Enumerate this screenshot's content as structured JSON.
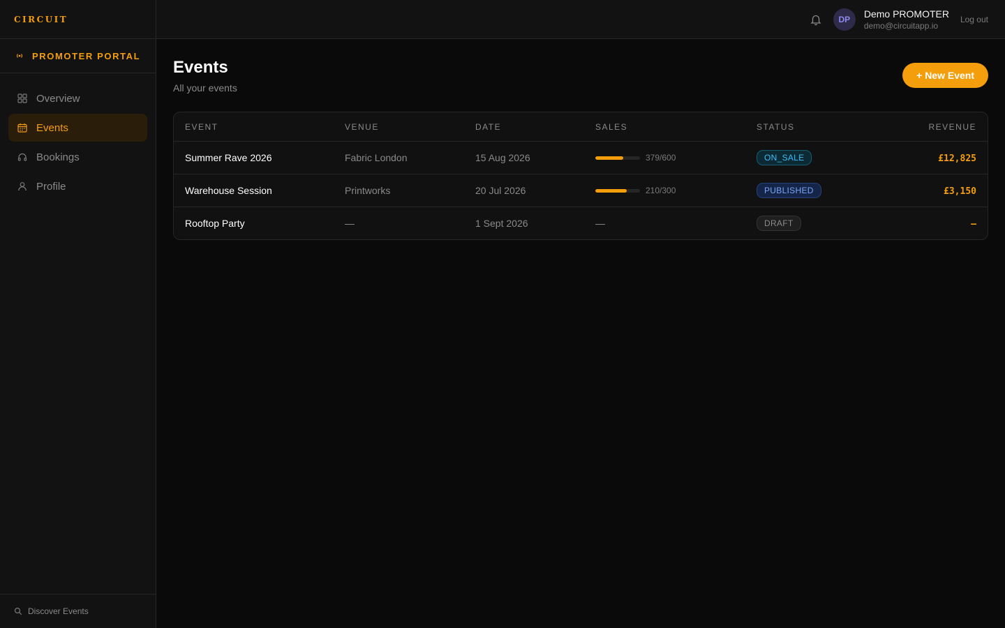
{
  "brand": {
    "logo": "CIRCUIT",
    "accent": "#f59e0b"
  },
  "portal": {
    "label": "PROMOTER PORTAL",
    "icon": "broadcast-icon"
  },
  "sidebar": {
    "items": [
      {
        "label": "Overview",
        "icon": "grid-icon",
        "active": false
      },
      {
        "label": "Events",
        "icon": "calendar-icon",
        "active": true
      },
      {
        "label": "Bookings",
        "icon": "headphones-icon",
        "active": false
      },
      {
        "label": "Profile",
        "icon": "user-icon",
        "active": false
      }
    ],
    "footer": {
      "label": "Discover Events",
      "icon": "search-icon"
    }
  },
  "topbar": {
    "avatar_initials": "DP",
    "user_name": "Demo PROMOTER",
    "user_email": "demo@circuitapp.io",
    "logout_label": "Log out"
  },
  "page": {
    "title": "Events",
    "subtitle": "All your events",
    "new_button": "+ New Event"
  },
  "table": {
    "columns": [
      "EVENT",
      "VENUE",
      "DATE",
      "SALES",
      "STATUS",
      "REVENUE"
    ],
    "rows": [
      {
        "event": "Summer Rave 2026",
        "venue": "Fabric London",
        "date": "15 Aug 2026",
        "sales": "379/600",
        "sold_fraction": 0.632,
        "status": "ON_SALE",
        "revenue": "£12,825"
      },
      {
        "event": "Warehouse Session",
        "venue": "Printworks",
        "date": "20 Jul 2026",
        "sales": "210/300",
        "sold_fraction": 0.7,
        "status": "PUBLISHED",
        "revenue": "£3,150"
      },
      {
        "event": "Rooftop Party",
        "venue": "—",
        "date": "1 Sept 2026",
        "sales": "—",
        "sold_fraction": null,
        "status": "DRAFT",
        "revenue": "—"
      }
    ]
  }
}
